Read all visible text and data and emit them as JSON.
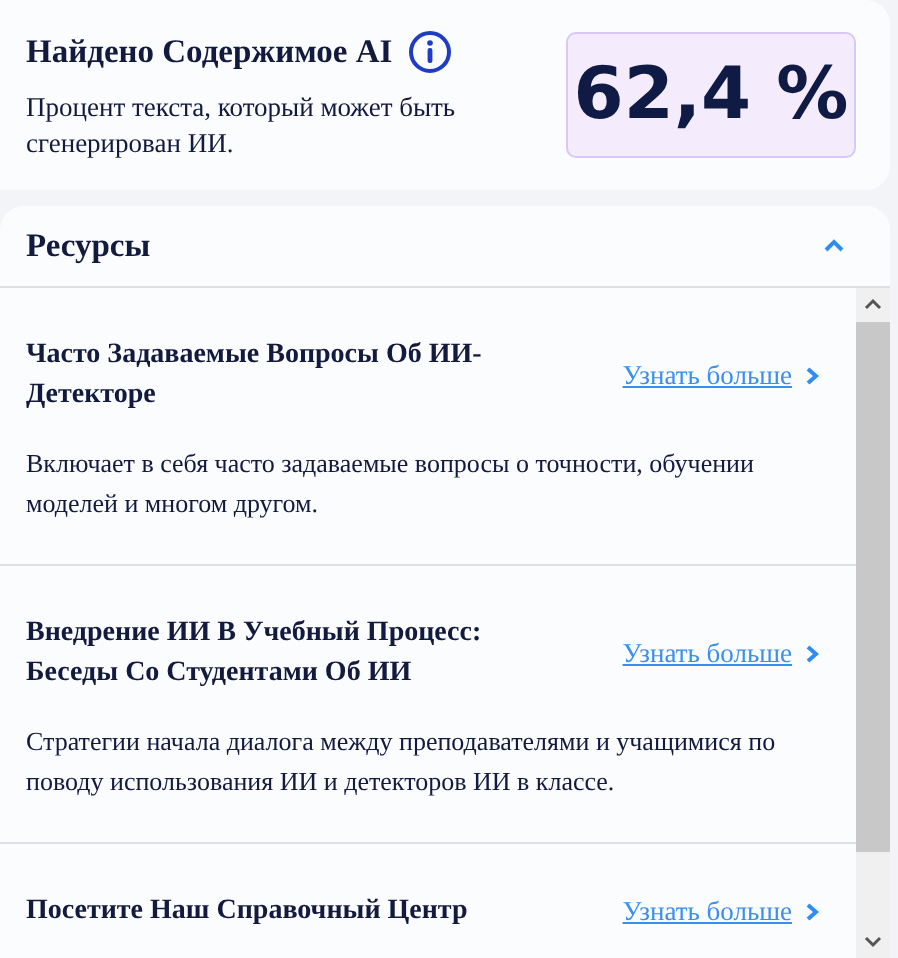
{
  "detection": {
    "title": "Найдено Содержимое AI",
    "description": "Процент текста, который может быть сгенерирован ИИ.",
    "percent": "62,4 %"
  },
  "resources": {
    "title": "Ресурсы",
    "expanded": true,
    "items": [
      {
        "title": "Часто Задаваемые Вопросы Об ИИ-Детекторе",
        "link": "Узнать больше",
        "description": "Включает в себя часто задаваемые вопросы о точности, обучении моделей и многом другом."
      },
      {
        "title": "Внедрение ИИ В Учебный Процесс: Беседы Со Студентами Об ИИ",
        "link": "Узнать больше",
        "description": "Стратегии начала диалога между преподавателями и учащимися по поводу использования ИИ и детекторов ИИ в классе."
      },
      {
        "title": "Посетите Наш Справочный Центр",
        "link": "Узнать больше"
      }
    ]
  }
}
